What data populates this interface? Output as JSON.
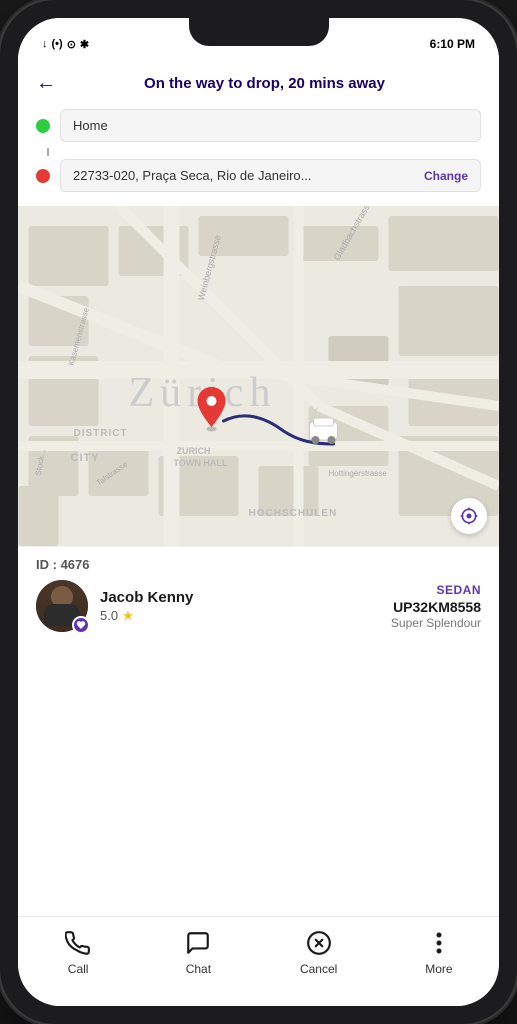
{
  "statusBar": {
    "time": "6:10 PM",
    "leftIcons": "↓(•) ♥ *"
  },
  "header": {
    "backLabel": "←",
    "title": "On the way to drop, 20 mins away"
  },
  "route": {
    "origin": "Home",
    "destination": "22733-020, Praça Seca, Rio de Janeiro...",
    "changeLabel": "Change"
  },
  "map": {
    "cityLabel": "Zürich",
    "districtLabel": "DISTRICT",
    "cityLabel2": "CITY",
    "townHallLabel": "ZURICH TOWN HALL",
    "hochschulenLabel": "HOCHSCHULEN"
  },
  "rideInfo": {
    "idLabel": "ID : ",
    "idValue": "4676",
    "vehicleType": "SEDAN",
    "driverName": "Jacob Kenny",
    "rating": "5.0",
    "vehiclePlate": "UP32KM8558",
    "vehicleModel": "Super Splendour"
  },
  "bottomNav": [
    {
      "id": "call",
      "label": "Call",
      "icon": "call"
    },
    {
      "id": "chat",
      "label": "Chat",
      "icon": "chat"
    },
    {
      "id": "cancel",
      "label": "Cancel",
      "icon": "cancel"
    },
    {
      "id": "more",
      "label": "More",
      "icon": "more"
    }
  ]
}
